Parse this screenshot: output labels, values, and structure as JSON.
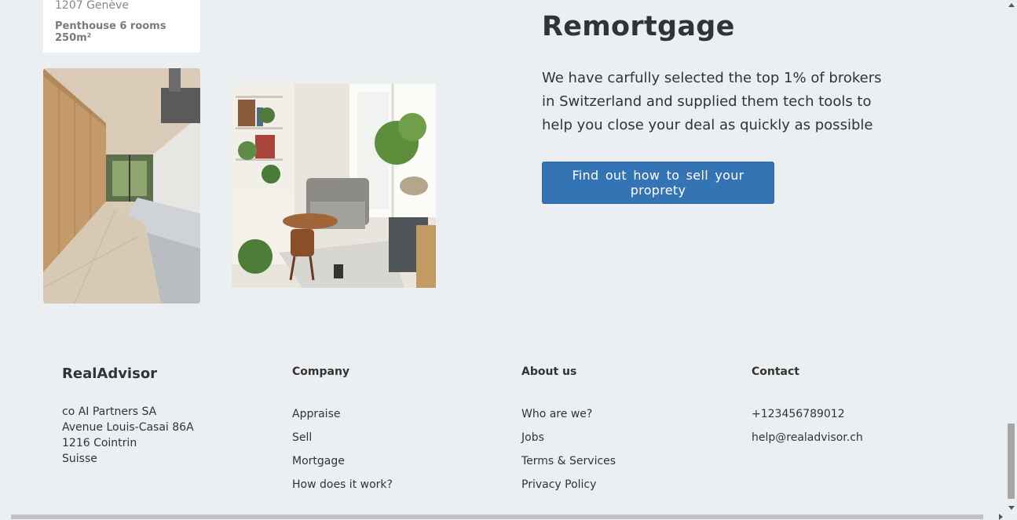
{
  "listing": {
    "address": "1207 Genève",
    "details": "Penthouse 6 rooms 250m²"
  },
  "hero": {
    "title": "Remortgage",
    "text": "We have carfully selected the top 1% of brokers in Switzerland and supplied them tech tools to help you close your deal as quickly as possible",
    "button_label": "Find out how to sell your proprety",
    "button_color": "#3473b4"
  },
  "footer": {
    "brand": "RealAdvisor",
    "address_lines": [
      "co AI Partners SA",
      "Avenue Louis-Casai 86A",
      "1216 Cointrin",
      "Suisse"
    ],
    "company": {
      "title": "Company",
      "links": [
        "Appraise",
        "Sell",
        "Mortgage",
        "How does it work?"
      ]
    },
    "about": {
      "title": "About us",
      "links": [
        "Who are we?",
        "Jobs",
        "Terms & Services",
        "Privacy Policy"
      ]
    },
    "contact": {
      "title": "Contact",
      "links": [
        "+123456789012",
        "help@realadvisor.ch"
      ]
    }
  },
  "colors": {
    "background": "#eceff1",
    "accent": "#3473b4"
  }
}
